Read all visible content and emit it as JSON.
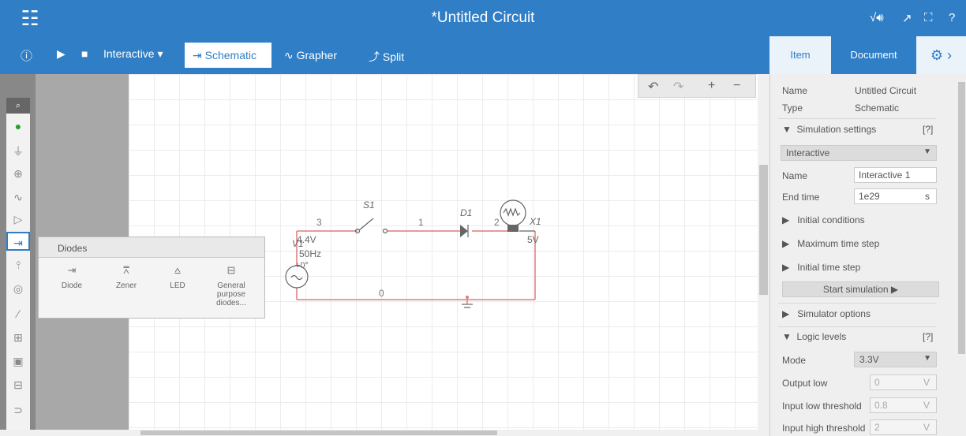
{
  "header": {
    "title": "Untitled Circuit",
    "modified_marker": "*",
    "apps_icon": "grid-icon",
    "right_icons": [
      "sqrt-sound-icon",
      "export-icon",
      "fullscreen-icon",
      "help-icon"
    ],
    "help_label": "?"
  },
  "toolbar": {
    "info_icon": "info-icon",
    "play_icon": "play-icon",
    "stop_icon": "stop-icon",
    "mode_label": "Interactive ▾",
    "tabs": [
      {
        "label": "Schematic",
        "icon": "diode-icon",
        "active": true
      },
      {
        "label": "Grapher",
        "icon": "wave-icon",
        "active": false
      },
      {
        "label": "Split",
        "icon": "split-icon",
        "active": false
      }
    ]
  },
  "right_tabs": {
    "item": "Item",
    "document": "Document",
    "gear": "⚙ ›"
  },
  "zoom_controls": {
    "undo": "↶",
    "redo": "↷",
    "zoom_in": "+",
    "zoom_out": "−"
  },
  "palette": {
    "search_icon": "search-icon",
    "items": [
      "probe-icon",
      "ground-icon",
      "source-icon",
      "resistor-icon",
      "buffer-icon",
      "diode-icon",
      "transistor-icon",
      "lamp-icon",
      "switch-icon",
      "relay-icon",
      "ic-icon",
      "logic-icon",
      "gate-icon"
    ]
  },
  "popup": {
    "title": "Diodes",
    "items": [
      {
        "label": "Diode",
        "icon": "diode-icon"
      },
      {
        "label": "Zener",
        "icon": "zener-icon"
      },
      {
        "label": "LED",
        "icon": "led-icon"
      },
      {
        "label": "General purpose diodes...",
        "icon": "diode-folder-icon"
      }
    ]
  },
  "circuit": {
    "source_name": "V1",
    "source_voltage": "4.4V",
    "source_freq": "50Hz",
    "source_phase": "+0°",
    "switch_name": "S1",
    "diode_name": "D1",
    "lamp_name": "X1",
    "lamp_rating": "5V",
    "nodes": [
      "3",
      "1",
      "2",
      "0"
    ]
  },
  "document": {
    "name_label": "Name",
    "name_value": "Untitled Circuit",
    "type_label": "Type",
    "type_value": "Schematic",
    "sim_settings": "Simulation settings",
    "help": "[?]",
    "sim_mode": "Interactive",
    "sim_name_label": "Name",
    "sim_name_value": "Interactive 1",
    "end_time_label": "End time",
    "end_time_value": "1e29",
    "end_time_unit": "s",
    "initial_conditions": "Initial conditions",
    "max_time_step": "Maximum time step",
    "initial_time_step": "Initial time step",
    "start_sim": "Start simulation ▶",
    "simulator_options": "Simulator options",
    "logic_levels": "Logic levels",
    "mode_label": "Mode",
    "mode_value": "3.3V",
    "output_low_label": "Output low",
    "output_low_value": "0",
    "unit_v": "V",
    "input_low_label": "Input low threshold",
    "input_low_value": "0.8",
    "input_high_label": "Input high threshold",
    "input_high_value": "2"
  },
  "colors": {
    "accent": "#2f7ec6",
    "wire": "#e07b7b"
  }
}
